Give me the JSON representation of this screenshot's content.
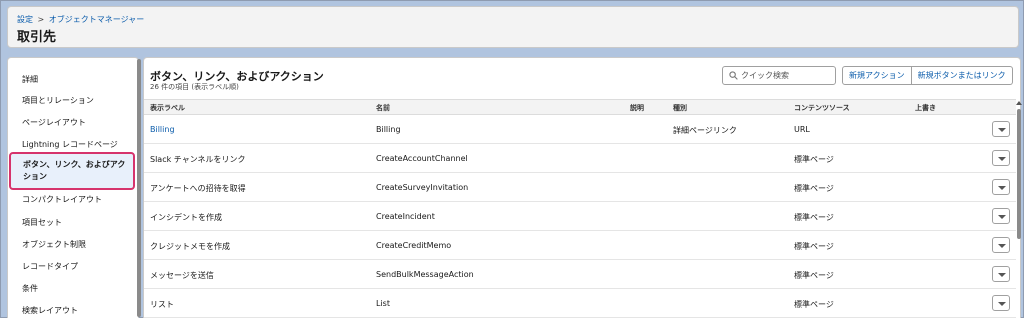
{
  "header": {
    "breadcrumb": [
      "設定",
      "オブジェクトマネージャー"
    ],
    "breadcrumb_sep": ">",
    "title": "取引先"
  },
  "sidebar": {
    "items": [
      {
        "label": "詳細"
      },
      {
        "label": "項目とリレーション"
      },
      {
        "label": "ページレイアウト"
      },
      {
        "label": "Lightning レコードページ"
      },
      {
        "label": "ボタン、リンク、およびアクション",
        "active": true
      },
      {
        "label": "コンパクトレイアウト"
      },
      {
        "label": "項目セット"
      },
      {
        "label": "オブジェクト制限"
      },
      {
        "label": "レコードタイプ"
      },
      {
        "label": "条件"
      },
      {
        "label": "検索レイアウト"
      }
    ]
  },
  "main": {
    "title": "ボタン、リンク、およびアクション",
    "subtitle": "26 件の項目 (表示ラベル順)",
    "search": {
      "placeholder": "クイック検索",
      "value": ""
    },
    "buttons": {
      "new_action": "新規アクション",
      "new_button_link": "新規ボタンまたはリンク"
    },
    "table": {
      "columns": {
        "label": "表示ラベル",
        "name": "名前",
        "description": "説明",
        "type": "種別",
        "content_source": "コンテンツソース",
        "overridden": "上書き"
      },
      "rows": [
        {
          "label": "Billing",
          "name": "Billing",
          "description": "",
          "type": "詳細ページリンク",
          "content_source": "URL",
          "overridden": "",
          "link": true
        },
        {
          "label": "Slack チャンネルをリンク",
          "name": "CreateAccountChannel",
          "description": "",
          "type": "",
          "content_source": "標準ページ",
          "overridden": ""
        },
        {
          "label": "アンケートへの招待を取得",
          "name": "CreateSurveyInvitation",
          "description": "",
          "type": "",
          "content_source": "標準ページ",
          "overridden": ""
        },
        {
          "label": "インシデントを作成",
          "name": "CreateIncident",
          "description": "",
          "type": "",
          "content_source": "標準ページ",
          "overridden": ""
        },
        {
          "label": "クレジットメモを作成",
          "name": "CreateCreditMemo",
          "description": "",
          "type": "",
          "content_source": "標準ページ",
          "overridden": ""
        },
        {
          "label": "メッセージを送信",
          "name": "SendBulkMessageAction",
          "description": "",
          "type": "",
          "content_source": "標準ページ",
          "overridden": ""
        },
        {
          "label": "リスト",
          "name": "List",
          "description": "",
          "type": "",
          "content_source": "標準ページ",
          "overridden": ""
        }
      ]
    }
  },
  "colors": {
    "accent": "#0b5cab",
    "highlight_border": "#d6336c",
    "frame": "#b0c4df"
  }
}
